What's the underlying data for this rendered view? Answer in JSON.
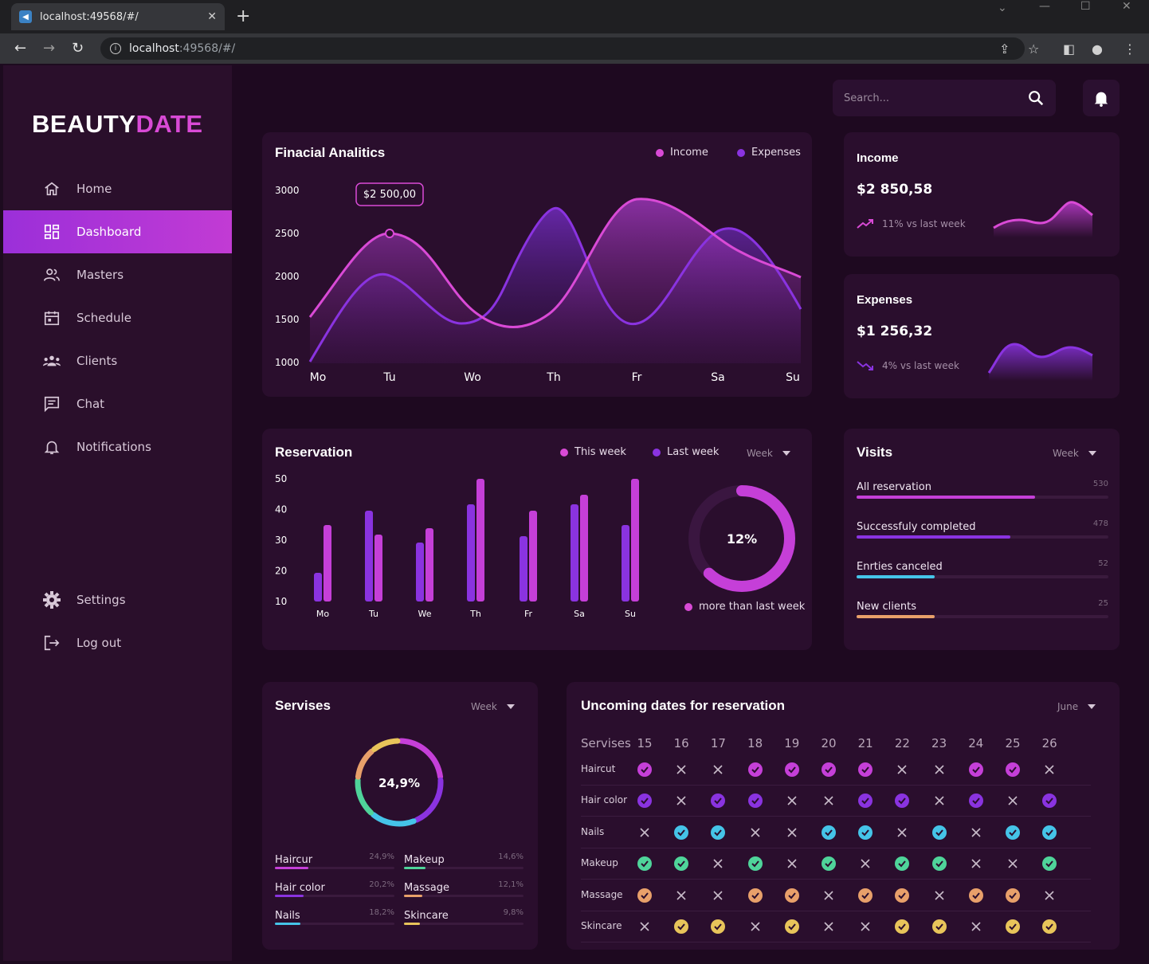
{
  "browser": {
    "tab_title": "localhost:49568/#/",
    "url_host": "localhost",
    "url_rest": ":49568/#/"
  },
  "app": {
    "logo_main": "BEAUTY",
    "logo_accent": "DATE",
    "accent_color": "#d94ad6",
    "secondary_color": "#8a33e0",
    "nav": [
      {
        "label": "Home",
        "icon": "home-icon",
        "active": false
      },
      {
        "label": "Dashboard",
        "icon": "dashboard-icon",
        "active": true
      },
      {
        "label": "Masters",
        "icon": "masters-icon",
        "active": false
      },
      {
        "label": "Schedule",
        "icon": "calendar-icon",
        "active": false
      },
      {
        "label": "Clients",
        "icon": "clients-icon",
        "active": false
      },
      {
        "label": "Chat",
        "icon": "chat-icon",
        "active": false
      },
      {
        "label": "Notifications",
        "icon": "bell-icon",
        "active": false
      }
    ],
    "bottom_nav": [
      {
        "label": "Settings",
        "icon": "gear-icon"
      },
      {
        "label": "Log out",
        "icon": "logout-icon"
      }
    ],
    "search_placeholder": "Search..."
  },
  "financial": {
    "title": "Finacial Analitics",
    "legend_income": "Income",
    "legend_expenses": "Expenses",
    "tooltip": "$2 500,00",
    "y_ticks": [
      "3000",
      "2500",
      "2000",
      "1500",
      "1000"
    ],
    "x_ticks": [
      "Mo",
      "Tu",
      "Wo",
      "Th",
      "Fr",
      "Sa",
      "Su"
    ]
  },
  "income_card": {
    "title": "Income",
    "value": "$2 850,58",
    "change": "11% vs last week"
  },
  "expenses_card": {
    "title": "Expenses",
    "value": "$1 256,32",
    "change": "4% vs last week"
  },
  "reservation": {
    "title": "Reservation",
    "legend_this": "This week",
    "legend_last": "Last week",
    "dropdown": "Week",
    "y_ticks": [
      "50",
      "40",
      "30",
      "20",
      "10"
    ],
    "x_ticks": [
      "Mo",
      "Tu",
      "We",
      "Th",
      "Fr",
      "Sa",
      "Su"
    ],
    "donut_value": "12%",
    "donut_fraction": 0.62,
    "donut_caption": "more than last week"
  },
  "visits": {
    "title": "Visits",
    "dropdown": "Week",
    "rows": [
      {
        "label": "All reservation",
        "value": "530",
        "fraction": 0.71,
        "color": "#c53fd8"
      },
      {
        "label": "Successfuly completed",
        "value": "478",
        "fraction": 0.61,
        "color": "#8a33e0"
      },
      {
        "label": "Enrties canceled",
        "value": "52",
        "fraction": 0.31,
        "color": "#45c4e8"
      },
      {
        "label": "New clients",
        "value": "25",
        "fraction": 0.31,
        "color": "#e8a06a"
      }
    ]
  },
  "services": {
    "title": "Servises",
    "dropdown": "Week",
    "donut_value": "24,9%",
    "items": [
      {
        "label": "Haircur",
        "pct": "24,9%",
        "fraction": 0.28,
        "color": "#c53fd8"
      },
      {
        "label": "Makeup",
        "pct": "14,6%",
        "fraction": 0.18,
        "color": "#4fd49a"
      },
      {
        "label": "Hair color",
        "pct": "20,2%",
        "fraction": 0.24,
        "color": "#8a33e0"
      },
      {
        "label": "Massage",
        "pct": "12,1%",
        "fraction": 0.15,
        "color": "#e8a06a"
      },
      {
        "label": "Nails",
        "pct": "18,2%",
        "fraction": 0.21,
        "color": "#45c4e8"
      },
      {
        "label": "Skincare",
        "pct": "9,8%",
        "fraction": 0.13,
        "color": "#e8c45a"
      }
    ]
  },
  "upcoming": {
    "title": "Uncoming dates for reservation",
    "dropdown": "June",
    "header_label": "Servises",
    "days": [
      "15",
      "16",
      "17",
      "18",
      "19",
      "20",
      "21",
      "22",
      "23",
      "24",
      "25",
      "26"
    ],
    "rows": [
      {
        "label": "Haircut",
        "color": "#c53fd8",
        "marks": [
          1,
          0,
          0,
          1,
          1,
          1,
          1,
          0,
          0,
          1,
          1,
          0
        ]
      },
      {
        "label": "Hair color",
        "color": "#8a33e0",
        "marks": [
          1,
          0,
          1,
          1,
          0,
          0,
          1,
          1,
          0,
          1,
          0,
          1
        ]
      },
      {
        "label": "Nails",
        "color": "#45c4e8",
        "marks": [
          0,
          1,
          1,
          0,
          0,
          1,
          1,
          0,
          1,
          0,
          1,
          1
        ]
      },
      {
        "label": "Makeup",
        "color": "#4fd49a",
        "marks": [
          1,
          1,
          0,
          1,
          0,
          1,
          0,
          1,
          1,
          0,
          0,
          1
        ]
      },
      {
        "label": "Massage",
        "color": "#e8a06a",
        "marks": [
          1,
          0,
          0,
          1,
          1,
          0,
          1,
          1,
          0,
          1,
          1,
          0
        ]
      },
      {
        "label": "Skincare",
        "color": "#e8c45a",
        "marks": [
          0,
          1,
          1,
          0,
          1,
          0,
          0,
          1,
          1,
          0,
          1,
          1
        ]
      }
    ]
  }
}
